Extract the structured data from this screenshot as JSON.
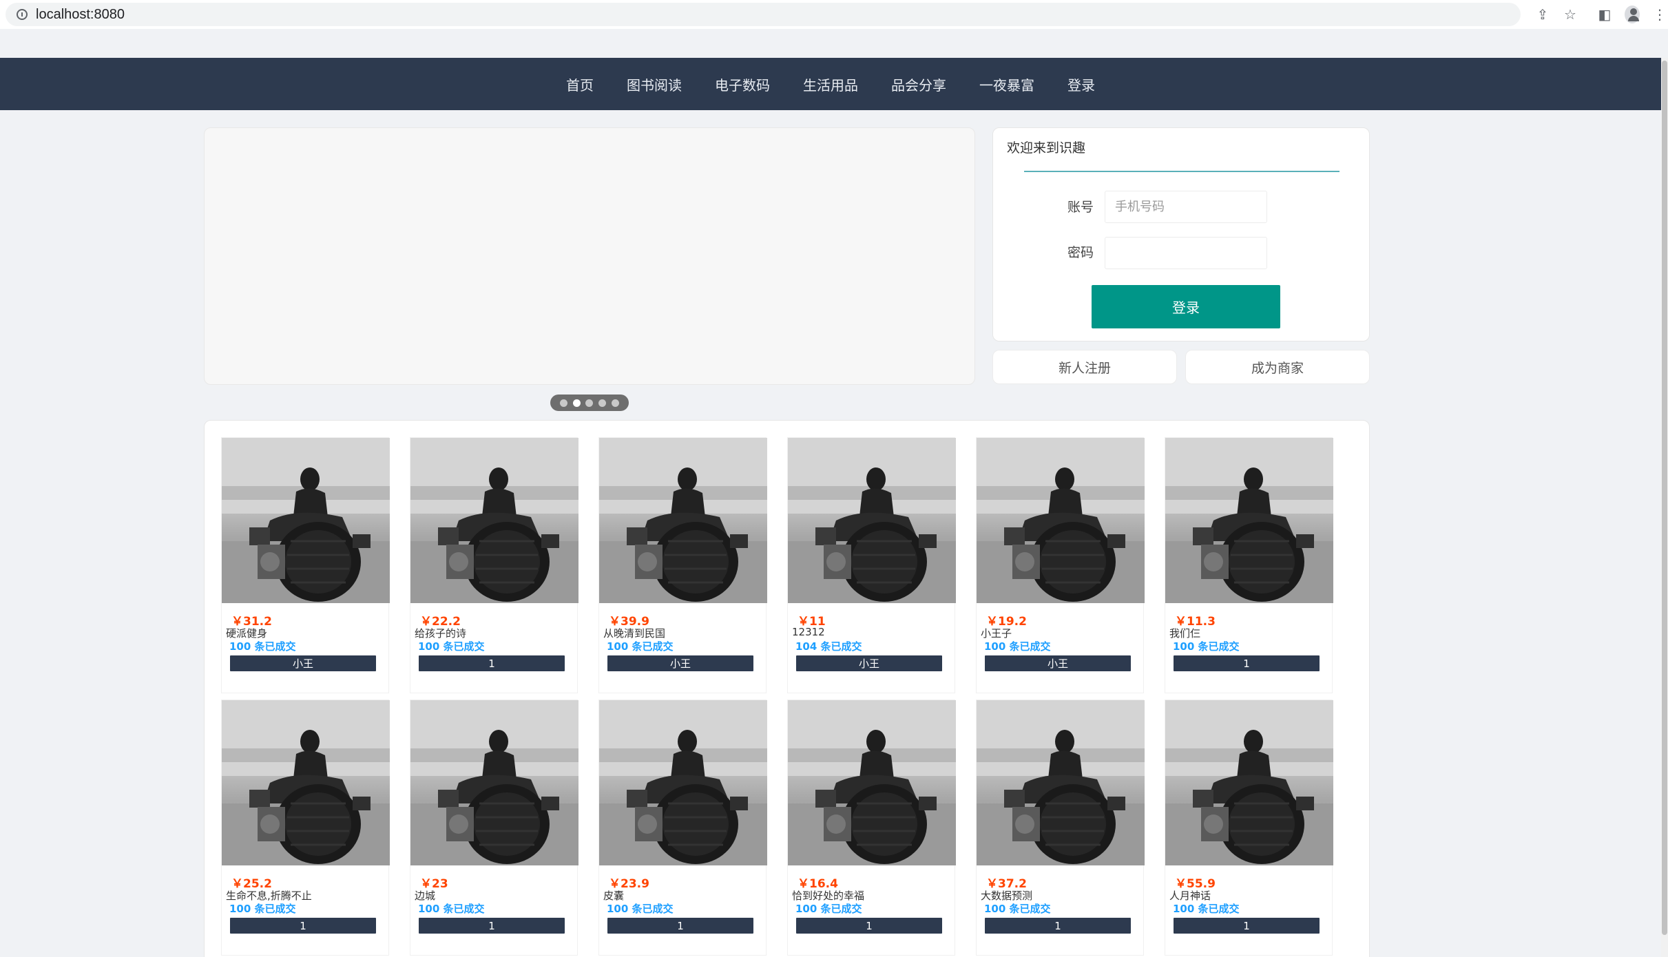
{
  "browser": {
    "url": "localhost:8080"
  },
  "nav": {
    "items": [
      "首页",
      "图书阅读",
      "电子数码",
      "生活用品",
      "品会分享",
      "一夜暴富",
      "登录"
    ]
  },
  "carousel": {
    "slide_count": 5,
    "active_index": 1
  },
  "login": {
    "title": "欢迎来到识趣",
    "account_label": "账号",
    "account_placeholder": "手机号码",
    "account_value": "",
    "password_label": "密码",
    "password_value": "",
    "submit_label": "登录",
    "register_label": "新人注册",
    "merchant_label": "成为商家"
  },
  "theme": {
    "nav_bg": "#2d3a4f",
    "primary": "#009688",
    "price_color": "#ff4400",
    "sales_color": "#1e9fff"
  },
  "products": [
    {
      "price": "￥31.2",
      "name": "硬派健身",
      "sales": "100 条已成交",
      "seller": "小王"
    },
    {
      "price": "￥22.2",
      "name": "给孩子的诗",
      "sales": "100 条已成交",
      "seller": "1"
    },
    {
      "price": "￥39.9",
      "name": "从晚清到民国",
      "sales": "100 条已成交",
      "seller": "小王"
    },
    {
      "price": "￥11",
      "name": "12312",
      "sales": "104 条已成交",
      "seller": "小王"
    },
    {
      "price": "￥19.2",
      "name": "小王子",
      "sales": "100 条已成交",
      "seller": "小王"
    },
    {
      "price": "￥11.3",
      "name": "我们仨",
      "sales": "100 条已成交",
      "seller": "1"
    },
    {
      "price": "￥25.2",
      "name": "生命不息,折腾不止",
      "sales": "100 条已成交",
      "seller": "1"
    },
    {
      "price": "￥23",
      "name": "边城",
      "sales": "100 条已成交",
      "seller": "1"
    },
    {
      "price": "￥23.9",
      "name": "皮囊",
      "sales": "100 条已成交",
      "seller": "1"
    },
    {
      "price": "￥16.4",
      "name": "恰到好处的幸福",
      "sales": "100 条已成交",
      "seller": "1"
    },
    {
      "price": "￥37.2",
      "name": "大数据预测",
      "sales": "100 条已成交",
      "seller": "1"
    },
    {
      "price": "￥55.9",
      "name": "人月神话",
      "sales": "100 条已成交",
      "seller": "1"
    }
  ]
}
